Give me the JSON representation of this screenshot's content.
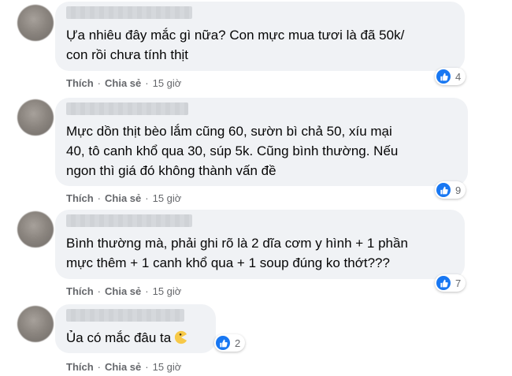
{
  "comments": [
    {
      "text": "Ựa nhiêu đây mắc gì nữa? Con mực mua tươi là đã 50k/\ncon rồi chưa tính thịt",
      "reaction_count": "4",
      "like_label": "Thích",
      "share_label": "Chia sẻ",
      "time": "15 giờ"
    },
    {
      "text": "Mực dồn thịt bèo lắm cũng 60, sườn bì chả 50, xíu mại\n40, tô canh khổ qua 30, súp 5k. Cũng bình thường. Nếu\nngon thì giá đó không thành vấn đề",
      "reaction_count": "9",
      "like_label": "Thích",
      "share_label": "Chia sẻ",
      "time": "15 giờ"
    },
    {
      "text": "Bình thường mà, phải ghi rõ là 2 dĩa cơm y hình + 1 phần\nmực thêm + 1 canh khổ qua + 1 soup đúng ko thớt???",
      "reaction_count": "7",
      "like_label": "Thích",
      "share_label": "Chia sẻ",
      "time": "15 giờ"
    },
    {
      "text": "Ủa có mắc đâu ta",
      "reaction_count": "2",
      "like_label": "Thích",
      "share_label": "Chia sẻ",
      "time": "15 giờ",
      "emoji": "pacman-emoji"
    }
  ],
  "separator": "·",
  "icons": {
    "reaction": "like-icon",
    "avatar": "blurred-avatar"
  },
  "colors": {
    "like_blue": "#1877f2",
    "bubble": "#f0f2f5",
    "meta_text": "#65676b"
  }
}
